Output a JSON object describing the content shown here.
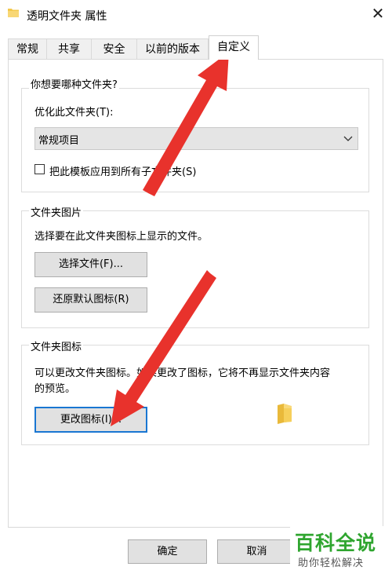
{
  "window": {
    "title": "透明文件夹 属性"
  },
  "tabs": [
    {
      "label": "常规"
    },
    {
      "label": "共享"
    },
    {
      "label": "安全"
    },
    {
      "label": "以前的版本"
    },
    {
      "label": "自定义",
      "active": true
    }
  ],
  "group_type": {
    "title": "你想要哪种文件夹?",
    "optimize_label": "优化此文件夹(T):",
    "select_value": "常规项目",
    "apply_checkbox_label": "把此模板应用到所有子文件夹(S)",
    "apply_checked": false
  },
  "group_picture": {
    "title": "文件夹图片",
    "desc": "选择要在此文件夹图标上显示的文件。",
    "choose_button": "选择文件(F)...",
    "restore_button": "还原默认图标(R)"
  },
  "group_icon": {
    "title": "文件夹图标",
    "desc_line1": "可以更改文件夹图标。如果更改了图标，它将不再显示文件夹内容",
    "desc_line2": "的预览。",
    "change_button": "更改图标(I)..."
  },
  "footer": {
    "ok": "确定",
    "cancel": "取消"
  },
  "watermark": {
    "main": "百科全说",
    "sub": "助你轻松解决"
  },
  "colors": {
    "annotation_arrow": "#e8322c",
    "focus_border": "#1976d2",
    "watermark_green": "#2fa52f"
  }
}
